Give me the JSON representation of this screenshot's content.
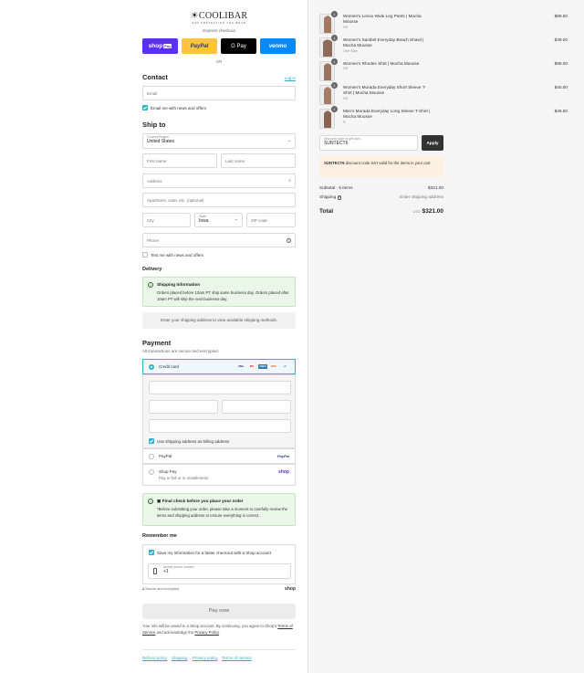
{
  "brand": {
    "name": "COOLIBAR",
    "tagline": "SUN PROTECTION YOU WEAR"
  },
  "express": {
    "label": "Express checkout",
    "shop": "shop",
    "shop_suffix": "Pay",
    "paypal": "PayPal",
    "gpay": "G Pay",
    "venmo": "venmo"
  },
  "or_label": "OR",
  "contact": {
    "title": "Contact",
    "login": "Log in",
    "email_placeholder": "Email",
    "newsletter": "Email me with news and offers"
  },
  "ship_to": {
    "title": "Ship to",
    "country_label": "Country/Region",
    "country_value": "United States",
    "first_name": "First name",
    "last_name": "Last name",
    "address": "Address",
    "apartment": "Apartment, suite, etc. (optional)",
    "city": "City",
    "state_label": "State",
    "state_value": "Iowa",
    "zip": "ZIP code",
    "phone": "Phone",
    "sms": "Text me with news and offers"
  },
  "delivery": {
    "title": "Delivery",
    "info_title": "Shipping Information",
    "info_text": "Orders placed before 10am PT ship same business day. Orders placed after 10am PT will ship the next business day.",
    "methods_placeholder": "Enter your shipping address to view available shipping methods."
  },
  "payment": {
    "title": "Payment",
    "subtitle": "All transactions are secure and encrypted.",
    "credit_card": "Credit card",
    "cards": [
      "VISA",
      "MC",
      "AMEX",
      "DISC",
      "+4"
    ],
    "billing_same": "Use shipping address as billing address",
    "paypal": "PayPal",
    "paypal_logo": "PayPal",
    "shoppay": "Shop Pay",
    "shoppay_sub": "Pay in full or in installments",
    "shoppay_logo": "shop"
  },
  "final_check": {
    "title": "Final check before you place your order",
    "text": "*Before submitting your order, please take a moment to carefully review the items and shipping address to ensure everything is correct."
  },
  "remember": {
    "title": "Remember me",
    "save_info": "Save my information for a faster checkout with a Shop account",
    "mobile_label": "Mobile phone number",
    "mobile_value": "+1",
    "secure": "Secure and encrypted",
    "shop_logo": "shop"
  },
  "pay_now": "Pay now",
  "disclaimer": {
    "text": "Your info will be saved to a Shop account. By continuing, you agree to Shop's",
    "terms": "Terms of Service",
    "and": "and acknowledge the",
    "privacy": "Privacy Policy",
    "end": "."
  },
  "footer": [
    "Refund policy",
    "Shipping",
    "Privacy policy",
    "Terms of service"
  ],
  "cart": {
    "items": [
      {
        "qty": "1",
        "name": "Women's Lenox Wide Leg Pants | Mocha Mousse",
        "variant": "XS",
        "price": "$89.00"
      },
      {
        "qty": "1",
        "name": "Women's Sanibel Everyday Beach Shawl | Mocha Mousse",
        "variant": "One Size",
        "price": "$39.00"
      },
      {
        "qty": "1",
        "name": "Women's Rhodes Shirt | Mocha Mousse",
        "variant": "XS",
        "price": "$99.00"
      },
      {
        "qty": "1",
        "name": "Women's Morada Everyday Short Sleeve T-Shirt | Mocha Mousse",
        "variant": "XS",
        "price": "$45.00"
      },
      {
        "qty": "1",
        "name": "Men's Morada Everyday Long Sleeve T-Shirt | Mocha Mousse",
        "variant": "S",
        "price": "$49.00"
      }
    ],
    "discount_label": "Discount code or gift card",
    "discount_value": "SUNTECT6",
    "apply": "Apply",
    "error_code": "SUNTECT6",
    "error_text": "discount code isn't valid for the items in your cart",
    "subtotal_label": "Subtotal · 5 items",
    "subtotal": "$321.00",
    "shipping_label": "Shipping",
    "shipping_value": "Enter shipping address",
    "total_label": "Total",
    "currency": "USD",
    "total": "$321.00"
  },
  "colors": {
    "accent": "#2fb5c9",
    "shop": "#5a31f4",
    "paypal": "#ffc439",
    "venmo": "#008cff",
    "mocha": "#a07864"
  }
}
